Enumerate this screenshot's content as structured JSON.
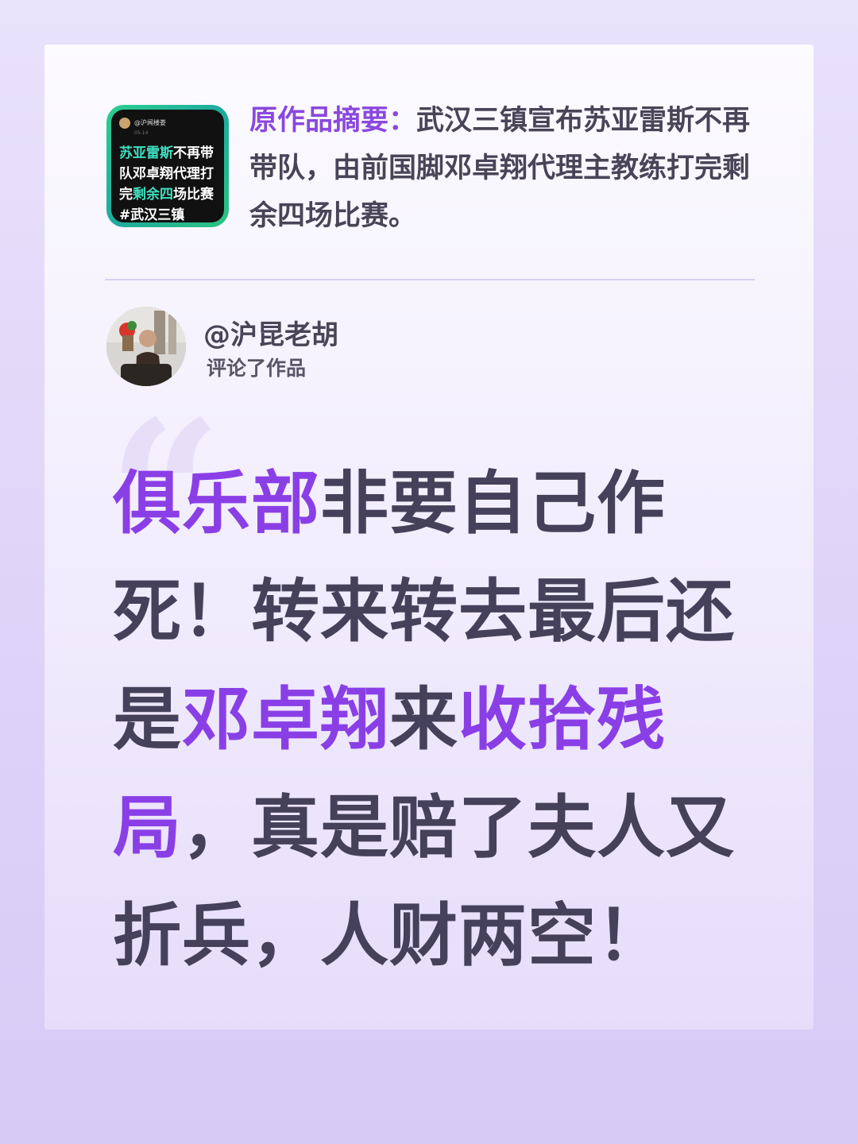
{
  "summary": {
    "thumbnail": {
      "account": "@沪闻楼娄",
      "date": "05-14",
      "text_hl1": "苏亚雷斯",
      "text_n1": "不再带队邓卓翔代理打完",
      "text_hl2": "剩余四",
      "text_n2": "场比赛#武汉三镇"
    },
    "label": "原作品摘要：",
    "text": "武汉三镇宣布苏亚雷斯不再带队，由前国脚邓卓翔代理主教练打完剩余四场比赛。"
  },
  "comment": {
    "user_name": "@沪昆老胡",
    "action": "评论了作品",
    "quote_open": "“",
    "segments": [
      {
        "text": "俱乐部",
        "highlight": true
      },
      {
        "text": "非要自己作死！转来转去最后还是",
        "highlight": false
      },
      {
        "text": "邓卓翔",
        "highlight": true
      },
      {
        "text": "来",
        "highlight": false
      },
      {
        "text": "收拾残局",
        "highlight": true
      },
      {
        "text": "，真是赔了夫人又折兵，人财两空！",
        "highlight": false
      }
    ]
  },
  "colors": {
    "accent": "#8a3fe6",
    "body_text": "#45415a",
    "thumb_border": "#2ccf8f",
    "thumb_highlight": "#3ee0c0"
  }
}
